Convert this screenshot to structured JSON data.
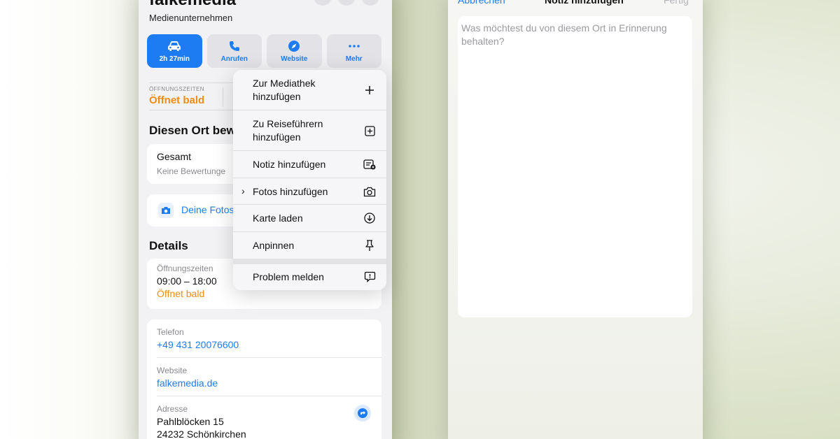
{
  "place": {
    "title": "falkemedia",
    "subtitle": "Medienunternehmen"
  },
  "header_buttons": {
    "share_glyph": "↑",
    "save_glyph": "□",
    "close_glyph": "✕"
  },
  "actions": [
    {
      "label": "2h 27min",
      "icon": "car-icon"
    },
    {
      "label": "Anrufen",
      "icon": "phone-icon"
    },
    {
      "label": "Website",
      "icon": "compass-icon"
    },
    {
      "label": "Mehr",
      "icon": "ellipsis-icon"
    }
  ],
  "hours_summary": {
    "caption": "ÖFFNUNGSZEITEN",
    "value": "Öffnet bald"
  },
  "rating": {
    "section_title": "Diesen Ort bew",
    "overall_label": "Gesamt",
    "overall_sub": "Keine Bewertunge"
  },
  "photos": {
    "label": "Deine Fotos"
  },
  "details": {
    "section_title": "Details",
    "hours_caption": "Öffnungszeiten",
    "hours_value": "09:00 – 18:00",
    "hours_status": "Öffnet bald",
    "phone_caption": "Telefon",
    "phone_value": "+49 431 20076600",
    "website_caption": "Website",
    "website_value": "falkemedia.de",
    "address_caption": "Adresse",
    "address_line1": "Pahlblöcken 15",
    "address_line2": "24232 Schönkirchen"
  },
  "menu": {
    "items": [
      {
        "line1": "Zur Mediathek",
        "line2": "hinzufügen",
        "icon": "plus-icon"
      },
      {
        "line1": "Zu Reiseführern",
        "line2": "hinzufügen",
        "icon": "plus-square-icon"
      },
      {
        "line1": "Notiz hinzufügen",
        "icon": "note-add-icon"
      },
      {
        "line1": "Fotos hinzufügen",
        "icon": "camera-icon",
        "chevron": "›"
      },
      {
        "line1": "Karte laden",
        "icon": "download-circle-icon"
      },
      {
        "line1": "Anpinnen",
        "icon": "pin-icon"
      },
      {
        "line1": "Problem melden",
        "icon": "report-bubble-icon"
      }
    ]
  },
  "note_sheet": {
    "cancel": "Abbrechen",
    "title": "Notiz hinzufügen",
    "done": "Fertig",
    "placeholder": "Was möchtest du von diesem Ort in Erinnerung behalten?"
  },
  "colors": {
    "accent": "#1e7cf2",
    "warning": "#f08c12"
  }
}
